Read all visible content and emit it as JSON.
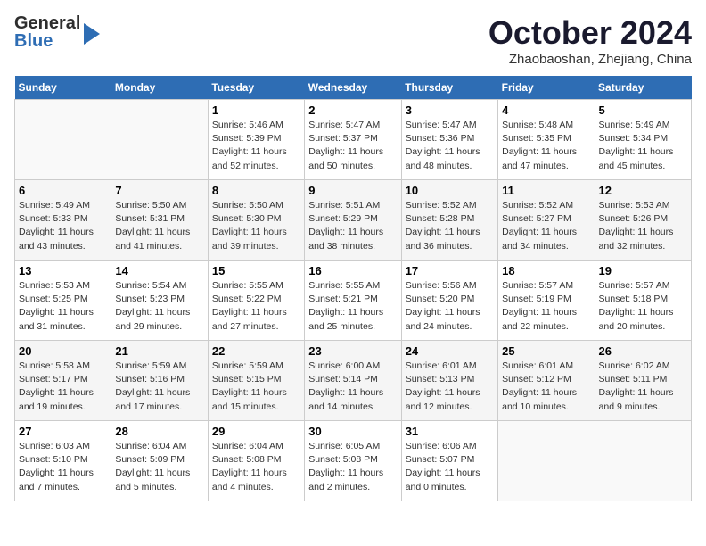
{
  "header": {
    "logo": {
      "line1": "General",
      "line2": "Blue"
    },
    "title": "October 2024",
    "location": "Zhaobaoshan, Zhejiang, China"
  },
  "weekdays": [
    "Sunday",
    "Monday",
    "Tuesday",
    "Wednesday",
    "Thursday",
    "Friday",
    "Saturday"
  ],
  "weeks": [
    [
      {
        "day": "",
        "info": ""
      },
      {
        "day": "",
        "info": ""
      },
      {
        "day": "1",
        "info": "Sunrise: 5:46 AM\nSunset: 5:39 PM\nDaylight: 11 hours and 52 minutes."
      },
      {
        "day": "2",
        "info": "Sunrise: 5:47 AM\nSunset: 5:37 PM\nDaylight: 11 hours and 50 minutes."
      },
      {
        "day": "3",
        "info": "Sunrise: 5:47 AM\nSunset: 5:36 PM\nDaylight: 11 hours and 48 minutes."
      },
      {
        "day": "4",
        "info": "Sunrise: 5:48 AM\nSunset: 5:35 PM\nDaylight: 11 hours and 47 minutes."
      },
      {
        "day": "5",
        "info": "Sunrise: 5:49 AM\nSunset: 5:34 PM\nDaylight: 11 hours and 45 minutes."
      }
    ],
    [
      {
        "day": "6",
        "info": "Sunrise: 5:49 AM\nSunset: 5:33 PM\nDaylight: 11 hours and 43 minutes."
      },
      {
        "day": "7",
        "info": "Sunrise: 5:50 AM\nSunset: 5:31 PM\nDaylight: 11 hours and 41 minutes."
      },
      {
        "day": "8",
        "info": "Sunrise: 5:50 AM\nSunset: 5:30 PM\nDaylight: 11 hours and 39 minutes."
      },
      {
        "day": "9",
        "info": "Sunrise: 5:51 AM\nSunset: 5:29 PM\nDaylight: 11 hours and 38 minutes."
      },
      {
        "day": "10",
        "info": "Sunrise: 5:52 AM\nSunset: 5:28 PM\nDaylight: 11 hours and 36 minutes."
      },
      {
        "day": "11",
        "info": "Sunrise: 5:52 AM\nSunset: 5:27 PM\nDaylight: 11 hours and 34 minutes."
      },
      {
        "day": "12",
        "info": "Sunrise: 5:53 AM\nSunset: 5:26 PM\nDaylight: 11 hours and 32 minutes."
      }
    ],
    [
      {
        "day": "13",
        "info": "Sunrise: 5:53 AM\nSunset: 5:25 PM\nDaylight: 11 hours and 31 minutes."
      },
      {
        "day": "14",
        "info": "Sunrise: 5:54 AM\nSunset: 5:23 PM\nDaylight: 11 hours and 29 minutes."
      },
      {
        "day": "15",
        "info": "Sunrise: 5:55 AM\nSunset: 5:22 PM\nDaylight: 11 hours and 27 minutes."
      },
      {
        "day": "16",
        "info": "Sunrise: 5:55 AM\nSunset: 5:21 PM\nDaylight: 11 hours and 25 minutes."
      },
      {
        "day": "17",
        "info": "Sunrise: 5:56 AM\nSunset: 5:20 PM\nDaylight: 11 hours and 24 minutes."
      },
      {
        "day": "18",
        "info": "Sunrise: 5:57 AM\nSunset: 5:19 PM\nDaylight: 11 hours and 22 minutes."
      },
      {
        "day": "19",
        "info": "Sunrise: 5:57 AM\nSunset: 5:18 PM\nDaylight: 11 hours and 20 minutes."
      }
    ],
    [
      {
        "day": "20",
        "info": "Sunrise: 5:58 AM\nSunset: 5:17 PM\nDaylight: 11 hours and 19 minutes."
      },
      {
        "day": "21",
        "info": "Sunrise: 5:59 AM\nSunset: 5:16 PM\nDaylight: 11 hours and 17 minutes."
      },
      {
        "day": "22",
        "info": "Sunrise: 5:59 AM\nSunset: 5:15 PM\nDaylight: 11 hours and 15 minutes."
      },
      {
        "day": "23",
        "info": "Sunrise: 6:00 AM\nSunset: 5:14 PM\nDaylight: 11 hours and 14 minutes."
      },
      {
        "day": "24",
        "info": "Sunrise: 6:01 AM\nSunset: 5:13 PM\nDaylight: 11 hours and 12 minutes."
      },
      {
        "day": "25",
        "info": "Sunrise: 6:01 AM\nSunset: 5:12 PM\nDaylight: 11 hours and 10 minutes."
      },
      {
        "day": "26",
        "info": "Sunrise: 6:02 AM\nSunset: 5:11 PM\nDaylight: 11 hours and 9 minutes."
      }
    ],
    [
      {
        "day": "27",
        "info": "Sunrise: 6:03 AM\nSunset: 5:10 PM\nDaylight: 11 hours and 7 minutes."
      },
      {
        "day": "28",
        "info": "Sunrise: 6:04 AM\nSunset: 5:09 PM\nDaylight: 11 hours and 5 minutes."
      },
      {
        "day": "29",
        "info": "Sunrise: 6:04 AM\nSunset: 5:08 PM\nDaylight: 11 hours and 4 minutes."
      },
      {
        "day": "30",
        "info": "Sunrise: 6:05 AM\nSunset: 5:08 PM\nDaylight: 11 hours and 2 minutes."
      },
      {
        "day": "31",
        "info": "Sunrise: 6:06 AM\nSunset: 5:07 PM\nDaylight: 11 hours and 0 minutes."
      },
      {
        "day": "",
        "info": ""
      },
      {
        "day": "",
        "info": ""
      }
    ]
  ]
}
